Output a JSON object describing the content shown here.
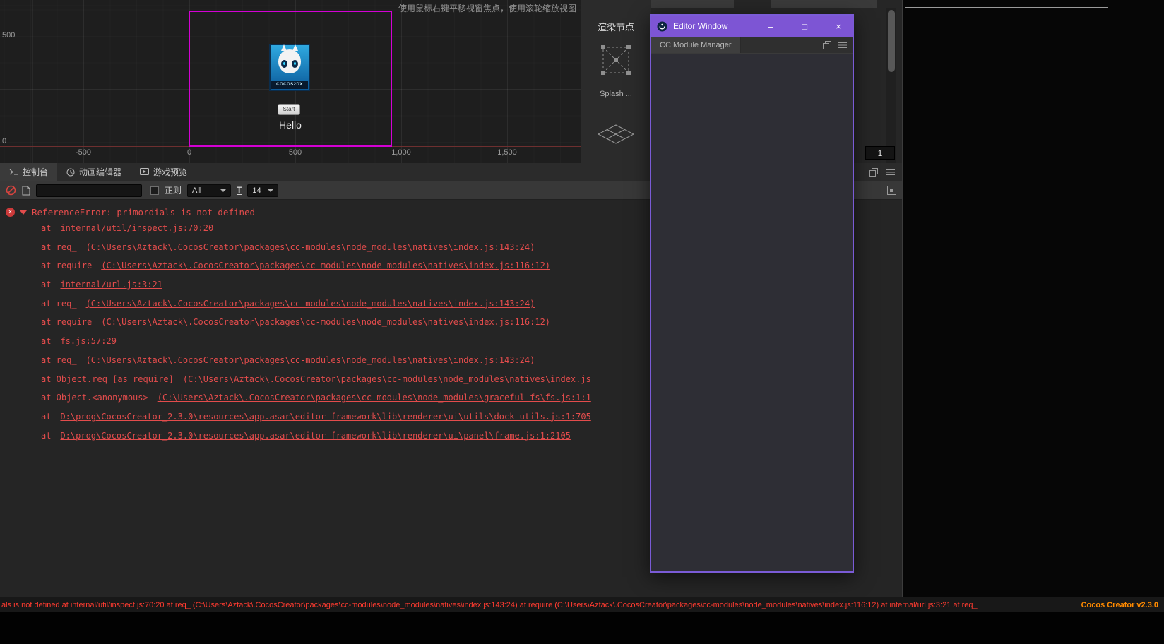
{
  "scene": {
    "hint": "使用鼠标右键平移视窗焦点，使用滚轮缩放视图",
    "ruler_left": [
      "500",
      "0"
    ],
    "ruler_bottom": [
      "-500",
      "0",
      "500",
      "1,000",
      "1,500"
    ],
    "logo_caption": "COCOS2DX",
    "button_label": "Start",
    "hello_label": "Hello"
  },
  "palette": {
    "title": "渲染节点",
    "item1_label": "Splash ..."
  },
  "topright": {
    "value_input": "1"
  },
  "editor_window": {
    "title": "Editor Window",
    "tab_label": "CC Module Manager",
    "minimize": "–",
    "maximize": "□",
    "close": "×"
  },
  "console": {
    "tabs": [
      {
        "label": "控制台"
      },
      {
        "label": "动画编辑器"
      },
      {
        "label": "游戏预览"
      }
    ],
    "toolbar": {
      "regex_label": "正则",
      "type_filter": "All",
      "font_icon": "T",
      "font_size": "14"
    },
    "error": {
      "message": "ReferenceError: primordials is not defined",
      "stack": [
        {
          "prefix": "at",
          "link": "internal/util/inspect.js:70:20"
        },
        {
          "prefix": "at req_",
          "link": "(C:\\Users\\Aztack\\.CocosCreator\\packages\\cc-modules\\node_modules\\natives\\index.js:143:24)"
        },
        {
          "prefix": "at require",
          "link": "(C:\\Users\\Aztack\\.CocosCreator\\packages\\cc-modules\\node_modules\\natives\\index.js:116:12)"
        },
        {
          "prefix": "at",
          "link": "internal/url.js:3:21"
        },
        {
          "prefix": "at req_",
          "link": "(C:\\Users\\Aztack\\.CocosCreator\\packages\\cc-modules\\node_modules\\natives\\index.js:143:24)"
        },
        {
          "prefix": "at require",
          "link": "(C:\\Users\\Aztack\\.CocosCreator\\packages\\cc-modules\\node_modules\\natives\\index.js:116:12)"
        },
        {
          "prefix": "at",
          "link": "fs.js:57:29"
        },
        {
          "prefix": "at req_",
          "link": "(C:\\Users\\Aztack\\.CocosCreator\\packages\\cc-modules\\node_modules\\natives\\index.js:143:24)"
        },
        {
          "prefix": "at Object.req [as require]",
          "link": "(C:\\Users\\Aztack\\.CocosCreator\\packages\\cc-modules\\node_modules\\natives\\index.js"
        },
        {
          "prefix": "at Object.<anonymous>",
          "link": "(C:\\Users\\Aztack\\.CocosCreator\\packages\\cc-modules\\node_modules\\graceful-fs\\fs.js:1:1"
        },
        {
          "prefix": "at",
          "link": "D:\\prog\\CocosCreator_2.3.0\\resources\\app.asar\\editor-framework\\lib\\renderer\\ui\\utils\\dock-utils.js:1:705"
        },
        {
          "prefix": "at",
          "link": "D:\\prog\\CocosCreator_2.3.0\\resources\\app.asar\\editor-framework\\lib\\renderer\\ui\\panel\\frame.js:1:2105"
        }
      ]
    }
  },
  "statusbar": {
    "message": "als is not defined at internal/util/inspect.js:70:20 at req_ (C:\\Users\\Aztack\\.CocosCreator\\packages\\cc-modules\\node_modules\\natives\\index.js:143:24) at require (C:\\Users\\Aztack\\.CocosCreator\\packages\\cc-modules\\node_modules\\natives\\index.js:116:12) at internal/url.js:3:21 at req_",
    "version": "Cocos Creator v2.3.0"
  }
}
